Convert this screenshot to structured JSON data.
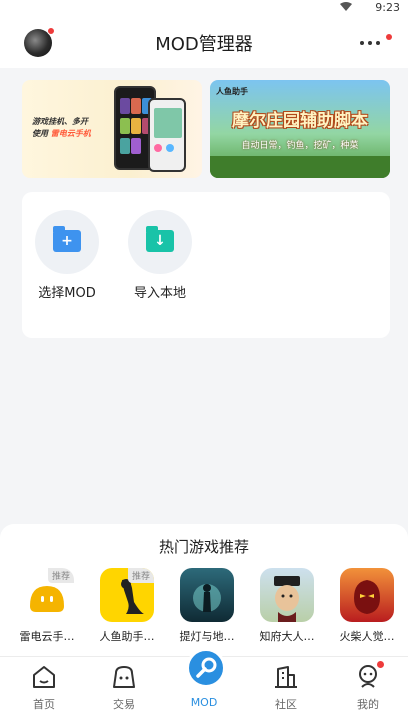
{
  "status_bar": {
    "time": "9:23",
    "wifi_icon": "wifi-icon"
  },
  "header": {
    "title": "MOD管理器",
    "avatar_icon": "avatar",
    "more_icon": "more-dots-icon"
  },
  "banners": [
    {
      "text_line1": "游戏挂机、多开",
      "text_line2_prefix": "使用",
      "text_line2_highlight": "雷电云手机"
    },
    {
      "top_tag": "人鱼助手",
      "title": "摩尔庄园辅助脚本",
      "subtitle": "自动日常，钓鱼，挖矿，种菜"
    }
  ],
  "actions": [
    {
      "label": "选择MOD",
      "icon": "folder-plus-icon"
    },
    {
      "label": "导入本地",
      "icon": "folder-download-icon"
    }
  ],
  "hot_section": {
    "title": "热门游戏推荐",
    "games": [
      {
        "name": "雷电云手…",
        "tag": "推荐",
        "color": "#f5b400"
      },
      {
        "name": "人鱼助手…",
        "tag": "推荐",
        "color": "#ffd500"
      },
      {
        "name": "提灯与地…",
        "tag": "",
        "color": "#1d3e4a"
      },
      {
        "name": "知府大人…",
        "tag": "",
        "color": "#c9a46d"
      },
      {
        "name": "火柴人觉…",
        "tag": "",
        "color": "#c8252a"
      }
    ]
  },
  "tabbar": {
    "tabs": [
      {
        "label": "首页",
        "icon": "home-icon"
      },
      {
        "label": "交易",
        "icon": "bag-icon"
      },
      {
        "label": "MOD",
        "icon": "wrench-icon",
        "active": true
      },
      {
        "label": "社区",
        "icon": "building-icon"
      },
      {
        "label": "我的",
        "icon": "profile-icon"
      }
    ]
  },
  "colors": {
    "accent": "#2a8fe0",
    "badge": "#ee3b3b"
  }
}
